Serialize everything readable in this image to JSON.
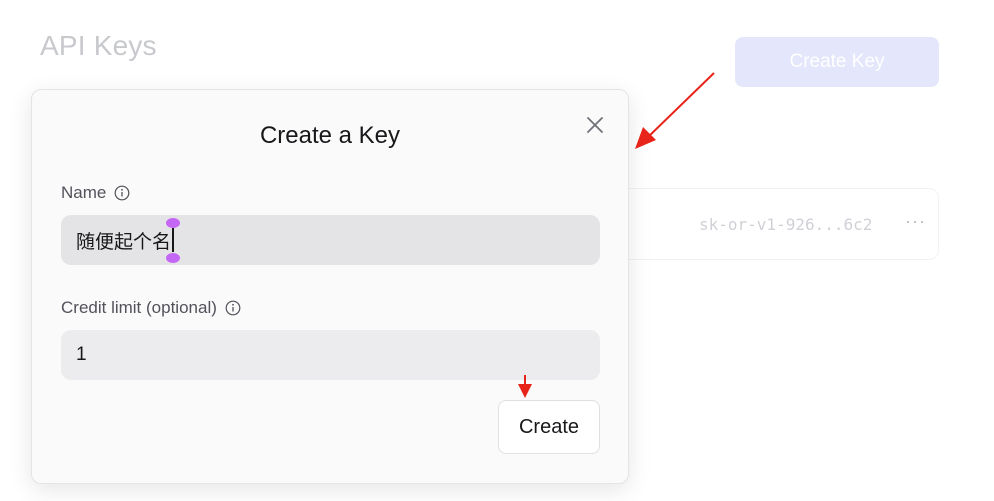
{
  "page": {
    "title": "API Keys",
    "create_key_label": "Create Key"
  },
  "key_row": {
    "masked_key": "sk-or-v1-926...6c2",
    "more_label": "···"
  },
  "modal": {
    "title": "Create a Key",
    "name_label": "Name",
    "name_value": "随便起个名",
    "credit_label": "Credit limit (optional)",
    "credit_value": "1",
    "create_label": "Create"
  },
  "icons": {
    "close": "close-icon",
    "info": "info-icon"
  },
  "colors": {
    "accent_light": "#e4e6fb",
    "annotation_red": "#e8231a",
    "selection_handle": "#c567f5"
  }
}
